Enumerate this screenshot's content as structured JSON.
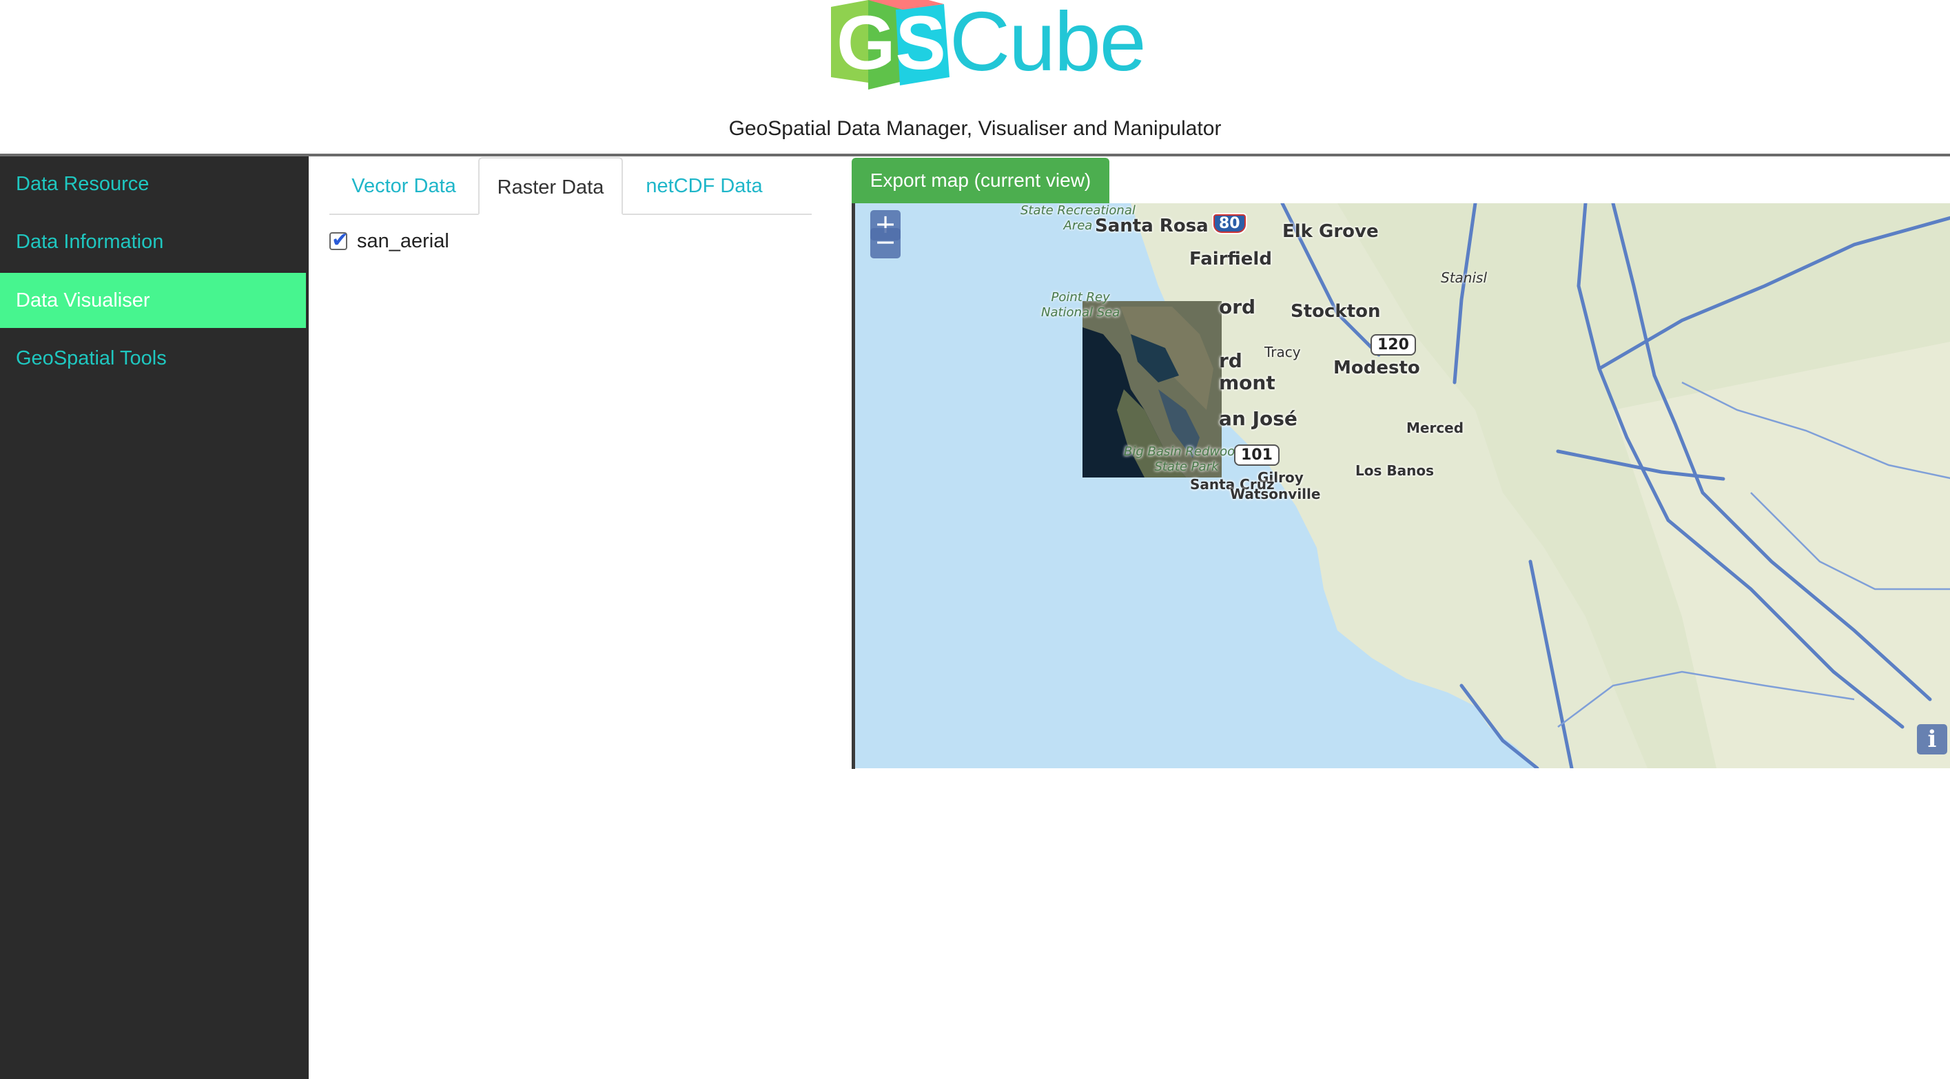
{
  "header": {
    "logo_letters": "GS",
    "logo_text": "Cube",
    "tagline": "GeoSpatial Data Manager, Visualiser and Manipulator"
  },
  "sidebar": {
    "items": [
      {
        "label": "Data Resource",
        "active": false
      },
      {
        "label": "Data Information",
        "active": false
      },
      {
        "label": "Data Visualiser",
        "active": true
      },
      {
        "label": "GeoSpatial Tools",
        "active": false
      }
    ]
  },
  "tabs": [
    {
      "label": "Vector Data",
      "active": false
    },
    {
      "label": "Raster Data",
      "active": true
    },
    {
      "label": "netCDF Data",
      "active": false
    }
  ],
  "layers": [
    {
      "label": "san_aerial",
      "checked": true
    }
  ],
  "export_button": "Export map (current view)",
  "map": {
    "zoom_in": "+",
    "zoom_out": "−",
    "info": "i",
    "labels": {
      "santa_rosa": "Santa Rosa",
      "elk_grove": "Elk Grove",
      "fairfield": "Fairfield",
      "stockton": "Stockton",
      "modesto": "Modesto",
      "tracy": "Tracy",
      "ord": "ord",
      "rd": "rd",
      "mont": "mont",
      "san_jose": "an José",
      "merced": "Merced",
      "los_banos": "Los Banos",
      "gilroy": "Gilroy",
      "santa_cruz": "Santa Cruz",
      "watsonville": "Watsonville",
      "stanislaus": "Stanisl",
      "state_rec": "State Recreational\nArea",
      "point_reyes": "Point Rey\nNational Sea",
      "big_basin": "Big Basin Redwoods\nState Park"
    },
    "shields": {
      "i80": "80",
      "us101": "101",
      "hwy120": "120"
    },
    "colors": {
      "ocean": "#bfe0f5",
      "land": "#e4e9d3",
      "roads": "#5b7fc4",
      "aerial_water": "#0f2233"
    }
  },
  "colors": {
    "sidebar_bg": "#2b2b2b",
    "sidebar_link": "#1fc7c0",
    "sidebar_active": "#47f58f",
    "export_green": "#4cae4f",
    "tab_link": "#1fb6c9"
  }
}
